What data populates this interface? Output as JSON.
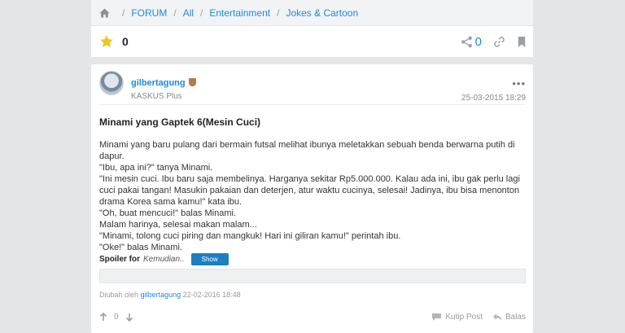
{
  "breadcrumb": {
    "items": [
      "FORUM",
      "All",
      "Entertainment",
      "Jokes & Cartoon"
    ],
    "separator": "/"
  },
  "rating": {
    "count": "0",
    "share_count": "0"
  },
  "post": {
    "username": "gilbertagung",
    "user_subtitle": "KASKUS Plus",
    "more": "•••",
    "date": "25-03-2015 18:29",
    "title": "Minami yang Gaptek 6(Mesin Cuci)",
    "lines": [
      "Minami yang baru pulang dari bermain futsal melihat ibunya meletakkan sebuah benda berwarna putih di dapur.",
      "\"Ibu, apa ini?\" tanya Minami.",
      "\"Ini mesin cuci. Ibu baru saja membelinya. Harganya sekitar Rp5.000.000. Kalau ada ini, ibu gak perlu lagi cuci pakai tangan! Masukin pakaian dan deterjen, atur waktu cucinya, selesai! Jadinya, ibu bisa menonton drama Korea sama kamu!\" kata ibu.",
      "\"Oh, buat mencuci!\" balas Minami.",
      "Malam harinya, selesai makan malam...",
      "\"Minami, tolong cuci piring dan mangkuk! Hari ini giliran kamu!\" perintah ibu.",
      "\"Oke!\" balas Minami."
    ],
    "spoiler_label": "Spoiler for",
    "spoiler_title": "Kemudian..",
    "spoiler_button": "Show",
    "edited_prefix": "Diubah oleh",
    "edited_by": "gilbertagung",
    "edited_date": "22-02-2016 18:48",
    "vote_count": "0",
    "quote_label": "Kutip Post",
    "reply_label": "Balas"
  },
  "colors": {
    "link": "#1d8bd6",
    "star": "#f5c518",
    "button": "#1d7fc0"
  },
  "icons": [
    "home-icon",
    "star-icon",
    "share-icon",
    "link-icon",
    "bookmark-icon",
    "badge-icon",
    "arrow-up-icon",
    "arrow-down-icon",
    "quote-icon",
    "reply-icon"
  ]
}
